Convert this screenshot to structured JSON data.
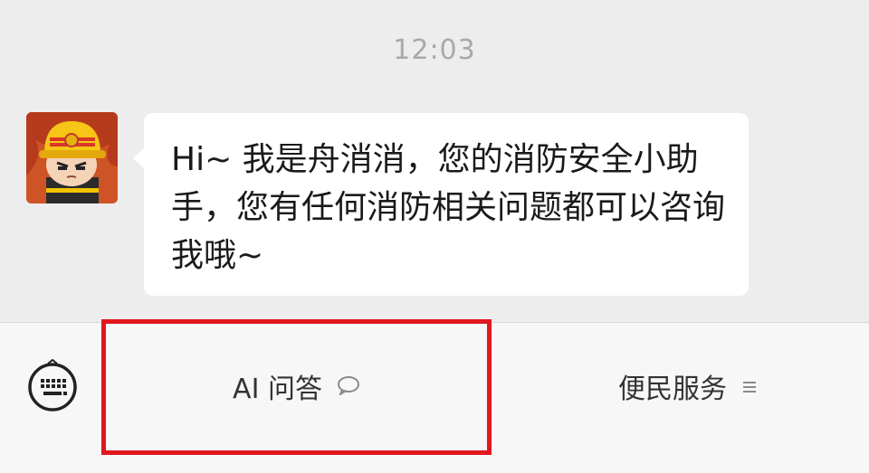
{
  "chat": {
    "timestamp": "12:03",
    "message": {
      "sender_avatar": "firefighter-mascot-avatar",
      "text": "Hi~ 我是舟消消，您的消防安全小助手，您有任何消防相关问题都可以咨询我哦~"
    }
  },
  "menu": {
    "keyboard_icon": "keyboard-icon",
    "items": [
      {
        "label": "AI 问答",
        "icon": "speech-bubble-icon"
      },
      {
        "label": "便民服务",
        "icon": "list-menu-icon"
      }
    ]
  },
  "annotation": {
    "highlight_color": "#e0181e"
  },
  "colors": {
    "chat_background": "#ededed",
    "bubble": "#ffffff",
    "menu_bar": "#f7f7f7"
  }
}
